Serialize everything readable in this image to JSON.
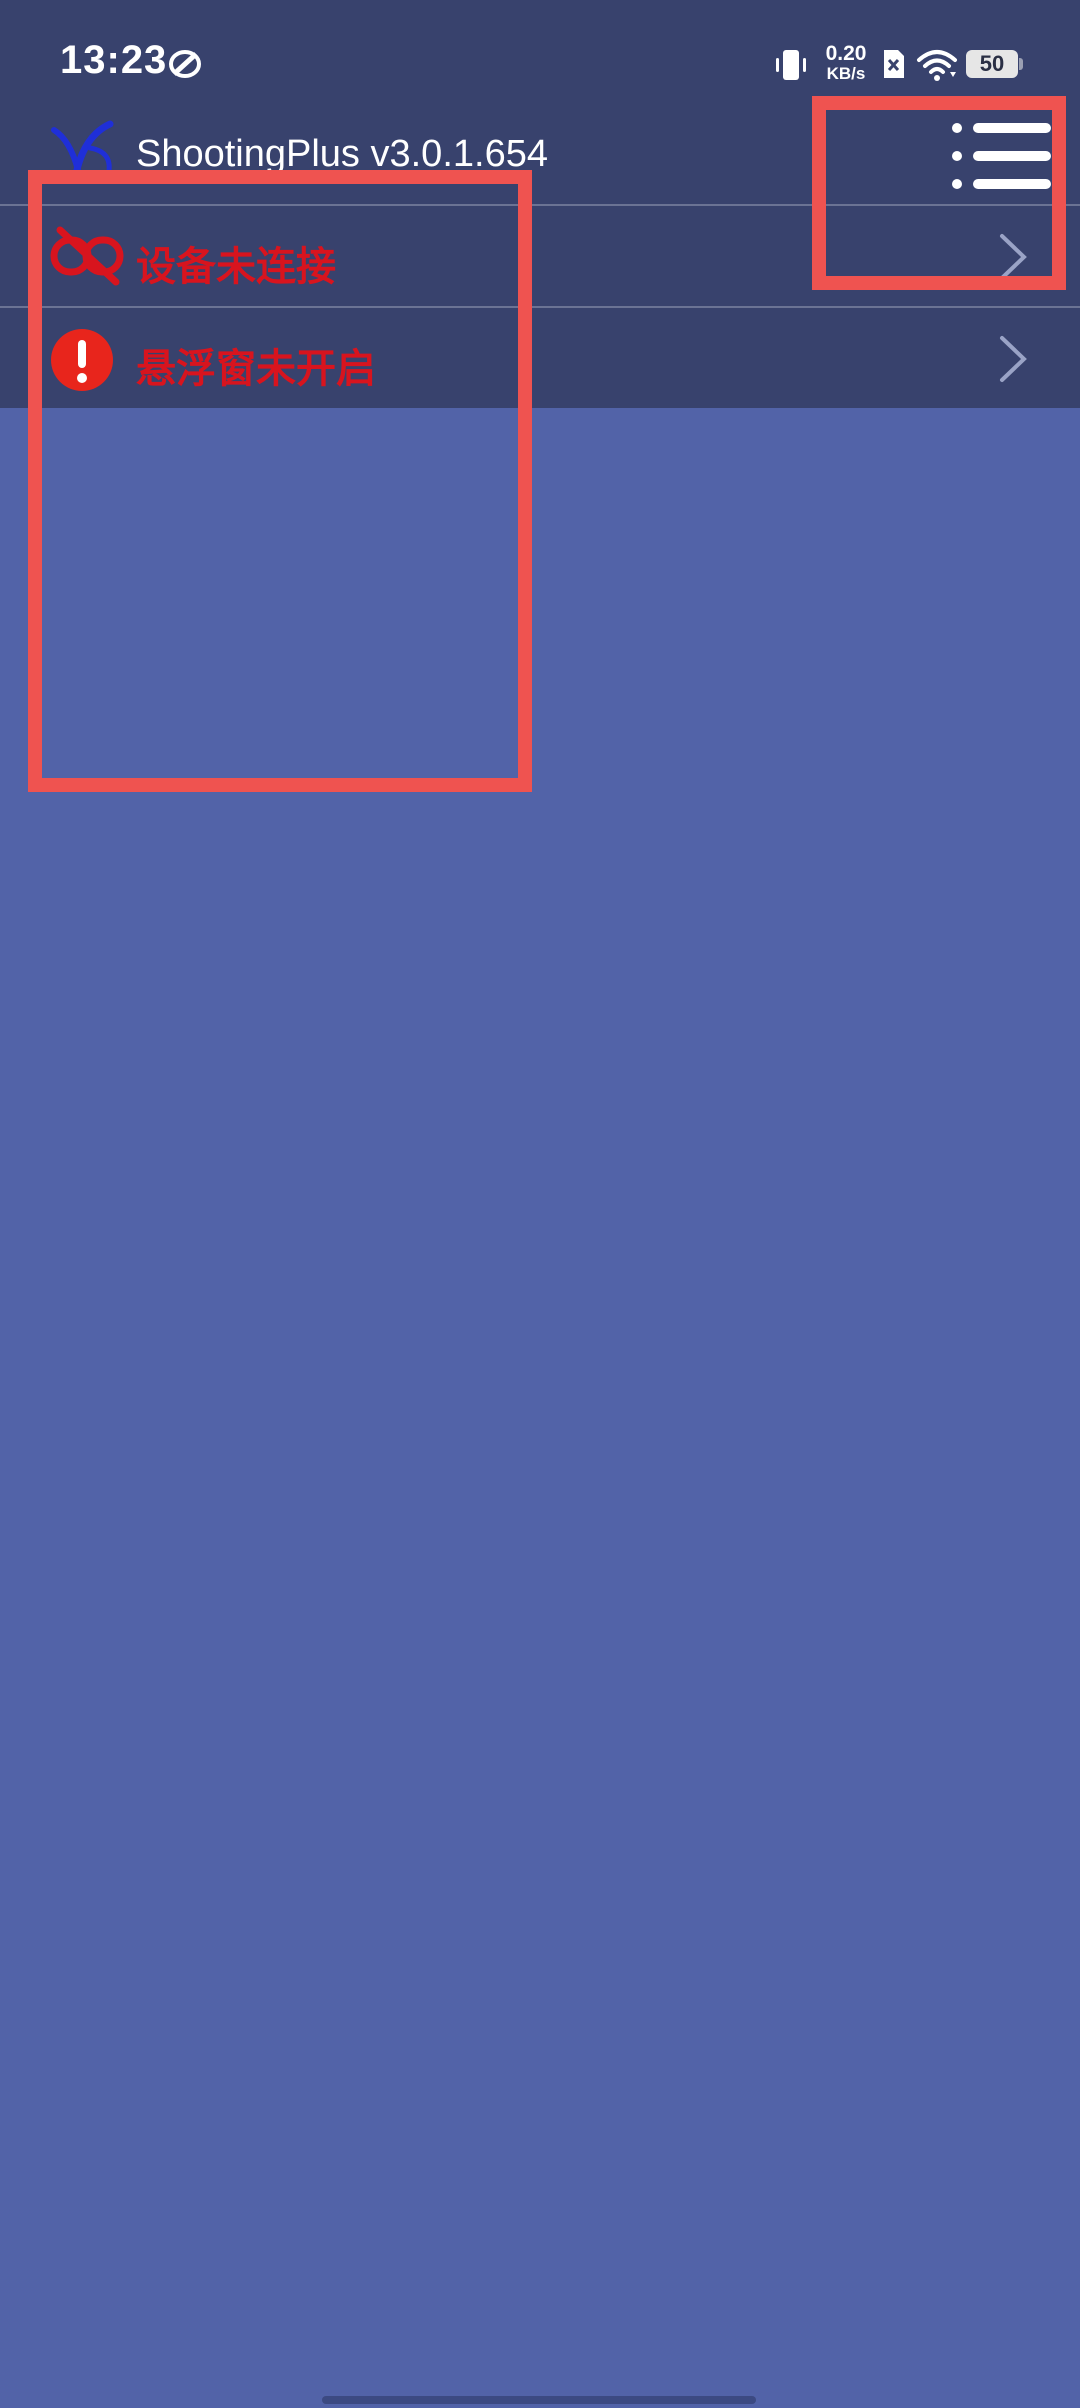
{
  "status_bar": {
    "time": "13:23",
    "net_speed_value": "0.20",
    "net_speed_unit": "KB/s",
    "battery_level": "50",
    "icons": [
      "app-notification-icon",
      "vibrate-icon",
      "sim-none-icon",
      "wifi-icon",
      "battery-icon"
    ]
  },
  "app_bar": {
    "title": "ShootingPlus v3.0.1.654",
    "logo_icon": "shootingplus-logo-icon",
    "menu_icon": "menu-list-icon"
  },
  "status_rows": [
    {
      "label": "设备未连接",
      "icon": "link-broken-icon"
    },
    {
      "label": "悬浮窗未开启",
      "icon": "alert-circle-icon"
    }
  ],
  "colors": {
    "header_bg": "#38426d",
    "page_bg": "#5263a8",
    "error_text": "#d8141e",
    "annotation": "#ef5350"
  }
}
